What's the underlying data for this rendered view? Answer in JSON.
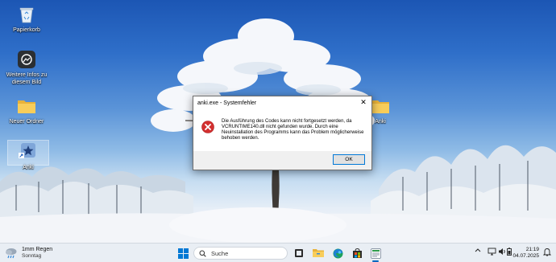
{
  "desktop": {
    "icons": [
      {
        "label": "Papierkorb",
        "icon": "recycle-bin-icon"
      },
      {
        "label": "Weitere Infos zu diesem Bild",
        "icon": "spotlight-info-icon"
      },
      {
        "label": "Neuer Ordner",
        "icon": "folder-icon"
      },
      {
        "label": "Anki",
        "icon": "anki-shortcut-icon"
      },
      {
        "label": "Anki",
        "icon": "folder-icon"
      }
    ]
  },
  "dialog": {
    "title": "anki.exe - Systemfehler",
    "close_glyph": "✕",
    "message": "Die Ausführung des Codes kann nicht fortgesetzt werden, da VCRUNTIME140.dll nicht gefunden wurde. Durch eine Neuinstallation des Programms kann das Problem möglicherweise behoben werden.",
    "ok_label": "OK",
    "icon": "error-icon"
  },
  "taskbar": {
    "weather": {
      "line1": "1mm Regen",
      "line2": "Sonntag",
      "icon": "rain-cloud-icon"
    },
    "search_label": "Suche",
    "apps": [
      "windows-start-icon",
      "search-icon",
      "task-view-icon",
      "file-explorer-icon",
      "edge-icon",
      "store-icon",
      "anki-app-icon"
    ],
    "tray": [
      "chevron-up-icon",
      "network-icon",
      "volume-icon",
      "battery-icon",
      "notification-bell-icon"
    ],
    "time": "21:19",
    "date": "04.07.2025"
  },
  "colors": {
    "accent": "#0078d7",
    "error": "#d32f2f",
    "taskbar": "#e9eef4"
  }
}
